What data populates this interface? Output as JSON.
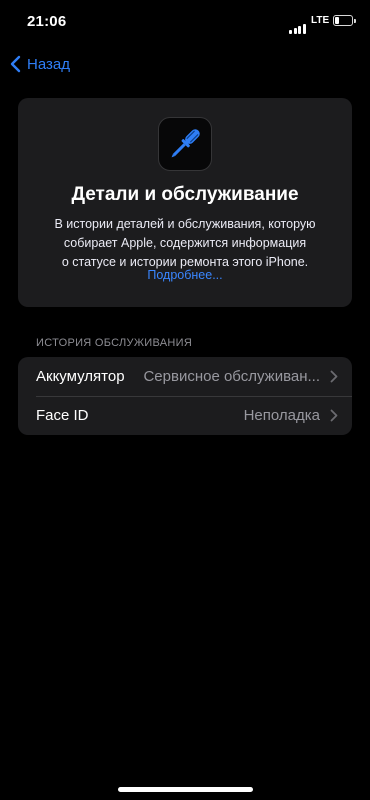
{
  "status_bar": {
    "time": "21:06",
    "network": "LTE"
  },
  "nav": {
    "back_label": "Назад"
  },
  "hero": {
    "icon": "screwdriver-icon",
    "title": "Детали и обслуживание",
    "description_lines": [
      "В истории деталей и обслуживания, которую",
      "собирает Apple, содержится информация",
      "о статусе и истории ремонта этого iPhone."
    ],
    "link": "Подробнее..."
  },
  "service_history": {
    "header": "ИСТОРИЯ ОБСЛУЖИВАНИЯ",
    "items": [
      {
        "label": "Аккумулятор",
        "value": "Сервисное обслуживан..."
      },
      {
        "label": "Face ID",
        "value": "Неполадка"
      }
    ]
  },
  "colors": {
    "background": "#000000",
    "card": "#1c1c1e",
    "accent": "#2f7ef6"
  }
}
